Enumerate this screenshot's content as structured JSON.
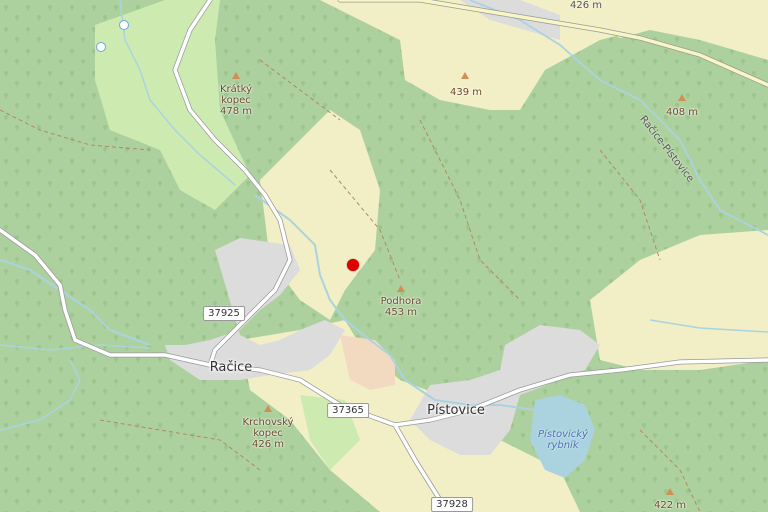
{
  "map": {
    "colors": {
      "forest": "#add19e",
      "meadow": "#f2efc7",
      "grass": "#cdebb0",
      "urban": "#dcdcdc",
      "water": "#aad3df",
      "road": "#ffffff",
      "main_road": "#f7f6c4",
      "marker": "#e00000"
    },
    "marker": {
      "name": "selected-location",
      "color": "#e00000"
    },
    "peaks": [
      {
        "name": "Krátký\nkopec",
        "elevation": "478 m"
      },
      {
        "name": "",
        "elevation": "439 m"
      },
      {
        "name": "",
        "elevation": "408 m"
      },
      {
        "name": "Podhora",
        "elevation": "453 m"
      },
      {
        "name": "Krchovský\nkopec",
        "elevation": "426 m"
      },
      {
        "name": "",
        "elevation": "422 m"
      }
    ],
    "towns": {
      "racice": "Račice",
      "pistovice": "Pístovice"
    },
    "road_shields": {
      "r37925": "37925",
      "r37365": "37365",
      "r37928": "37928"
    },
    "water": {
      "pond": "Pístovický\nrybník"
    },
    "labels": {
      "road_name": "Račice-Pístovice",
      "top_elevation": "426 m"
    }
  }
}
